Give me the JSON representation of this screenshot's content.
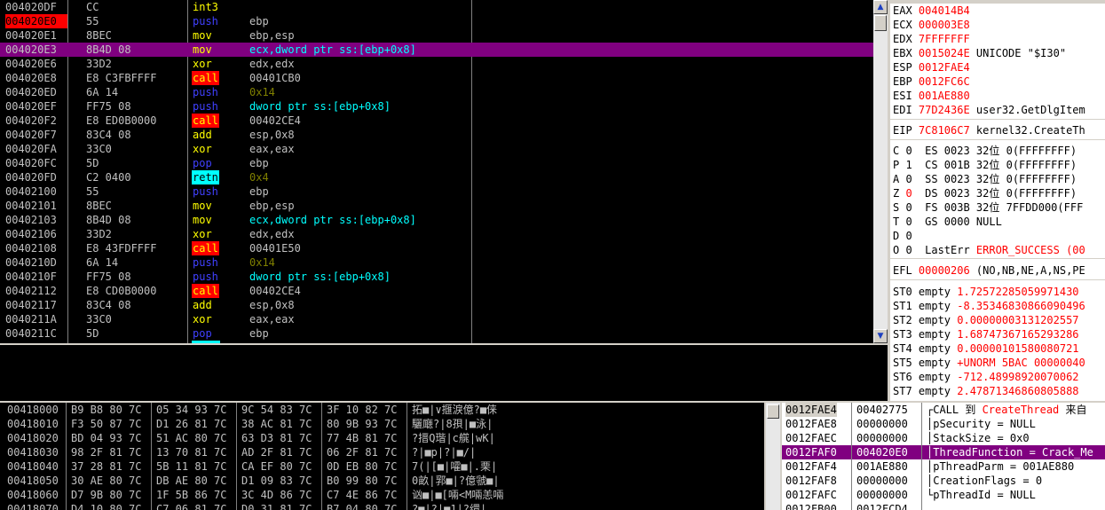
{
  "disasm": {
    "rows": [
      {
        "addr": "004020DF",
        "hex": "CC",
        "mn": "int3",
        "mk": "def",
        "op": "",
        "ok": "def"
      },
      {
        "addr": "004020E0",
        "hex": "55",
        "mn": "push",
        "mk": "stk",
        "op": "ebp",
        "ok": "def",
        "bp": true
      },
      {
        "addr": "004020E1",
        "hex": "8BEC",
        "mn": "mov",
        "mk": "def",
        "op": "ebp,esp",
        "ok": "def"
      },
      {
        "addr": "004020E3",
        "hex": "8B4D 08",
        "mn": "mov",
        "mk": "def",
        "op": "ecx,dword ptr ss:[ebp+0x8]",
        "ok": "mem",
        "sel": true
      },
      {
        "addr": "004020E6",
        "hex": "33D2",
        "mn": "xor",
        "mk": "def",
        "op": "edx,edx",
        "ok": "def"
      },
      {
        "addr": "004020E8",
        "hex": "E8 C3FBFFFF",
        "mn": "call",
        "mk": "call",
        "op": "00401CB0",
        "ok": "def"
      },
      {
        "addr": "004020ED",
        "hex": "6A 14",
        "mn": "push",
        "mk": "stk",
        "op": "0x14",
        "ok": "imm"
      },
      {
        "addr": "004020EF",
        "hex": "FF75 08",
        "mn": "push",
        "mk": "stk",
        "op": "dword ptr ss:[ebp+0x8]",
        "ok": "mem"
      },
      {
        "addr": "004020F2",
        "hex": "E8 ED0B0000",
        "mn": "call",
        "mk": "call",
        "op": "00402CE4",
        "ok": "def"
      },
      {
        "addr": "004020F7",
        "hex": "83C4 08",
        "mn": "add",
        "mk": "def",
        "op": "esp,0x8",
        "ok": "def"
      },
      {
        "addr": "004020FA",
        "hex": "33C0",
        "mn": "xor",
        "mk": "def",
        "op": "eax,eax",
        "ok": "def"
      },
      {
        "addr": "004020FC",
        "hex": "5D",
        "mn": "pop",
        "mk": "stk",
        "op": "ebp",
        "ok": "def"
      },
      {
        "addr": "004020FD",
        "hex": "C2 0400",
        "mn": "retn",
        "mk": "ret",
        "op": "0x4",
        "ok": "imm"
      },
      {
        "addr": "00402100",
        "hex": "55",
        "mn": "push",
        "mk": "stk",
        "op": "ebp",
        "ok": "def"
      },
      {
        "addr": "00402101",
        "hex": "8BEC",
        "mn": "mov",
        "mk": "def",
        "op": "ebp,esp",
        "ok": "def"
      },
      {
        "addr": "00402103",
        "hex": "8B4D 08",
        "mn": "mov",
        "mk": "def",
        "op": "ecx,dword ptr ss:[ebp+0x8]",
        "ok": "mem"
      },
      {
        "addr": "00402106",
        "hex": "33D2",
        "mn": "xor",
        "mk": "def",
        "op": "edx,edx",
        "ok": "def"
      },
      {
        "addr": "00402108",
        "hex": "E8 43FDFFFF",
        "mn": "call",
        "mk": "call",
        "op": "00401E50",
        "ok": "def"
      },
      {
        "addr": "0040210D",
        "hex": "6A 14",
        "mn": "push",
        "mk": "stk",
        "op": "0x14",
        "ok": "imm"
      },
      {
        "addr": "0040210F",
        "hex": "FF75 08",
        "mn": "push",
        "mk": "stk",
        "op": "dword ptr ss:[ebp+0x8]",
        "ok": "mem"
      },
      {
        "addr": "00402112",
        "hex": "E8 CD0B0000",
        "mn": "call",
        "mk": "call",
        "op": "00402CE4",
        "ok": "def"
      },
      {
        "addr": "00402117",
        "hex": "83C4 08",
        "mn": "add",
        "mk": "def",
        "op": "esp,0x8",
        "ok": "def"
      },
      {
        "addr": "0040211A",
        "hex": "33C0",
        "mn": "xor",
        "mk": "def",
        "op": "eax,eax",
        "ok": "def"
      },
      {
        "addr": "0040211C",
        "hex": "5D",
        "mn": "pop",
        "mk": "stk",
        "op": "ebp",
        "ok": "def"
      }
    ]
  },
  "registers": {
    "rows": [
      [
        {
          "t": "EAX "
        },
        {
          "t": "004014B4",
          "c": "red"
        }
      ],
      [
        {
          "t": "ECX "
        },
        {
          "t": "000003E8",
          "c": "red"
        }
      ],
      [
        {
          "t": "EDX "
        },
        {
          "t": "7FFFFFFF",
          "c": "red"
        }
      ],
      [
        {
          "t": "EBX "
        },
        {
          "t": "0015024E",
          "c": "red"
        },
        {
          "t": " UNICODE \"$I30\""
        }
      ],
      [
        {
          "t": "ESP "
        },
        {
          "t": "0012FAE4",
          "c": "red"
        }
      ],
      [
        {
          "t": "EBP "
        },
        {
          "t": "0012FC6C",
          "c": "red"
        }
      ],
      [
        {
          "t": "ESI "
        },
        {
          "t": "001AE880",
          "c": "red"
        }
      ],
      [
        {
          "t": "EDI "
        },
        {
          "t": "77D2436E",
          "c": "red"
        },
        {
          "t": " user32.GetDlgItem"
        }
      ],
      [],
      [
        {
          "t": "EIP "
        },
        {
          "t": "7C8106C7",
          "c": "red"
        },
        {
          "t": " kernel32.CreateTh"
        }
      ],
      [],
      [
        {
          "t": "C 0  ES 0023 32位 0(FFFFFFFF)"
        }
      ],
      [
        {
          "t": "P 1  CS 001B 32位 0(FFFFFFFF)"
        }
      ],
      [
        {
          "t": "A 0  SS 0023 32位 0(FFFFFFFF)"
        }
      ],
      [
        {
          "t": "Z "
        },
        {
          "t": "0",
          "c": "red"
        },
        {
          "t": "  DS 0023 32位 0(FFFFFFFF)"
        }
      ],
      [
        {
          "t": "S 0  FS 003B 32位 7FFDD000(FFF"
        }
      ],
      [
        {
          "t": "T 0  GS 0000 NULL"
        }
      ],
      [
        {
          "t": "D 0"
        }
      ],
      [
        {
          "t": "O 0  LastErr "
        },
        {
          "t": "ERROR_SUCCESS (00",
          "c": "red"
        }
      ],
      [],
      [
        {
          "t": "EFL "
        },
        {
          "t": "00000206",
          "c": "red"
        },
        {
          "t": " (NO,NB,NE,A,NS,PE"
        }
      ],
      [],
      [
        {
          "t": "ST0 empty "
        },
        {
          "t": "1.72572285059971430",
          "c": "red"
        }
      ],
      [
        {
          "t": "ST1 empty "
        },
        {
          "t": "-8.35346830866090496",
          "c": "red"
        }
      ],
      [
        {
          "t": "ST2 empty "
        },
        {
          "t": "0.00000003131202557",
          "c": "red"
        }
      ],
      [
        {
          "t": "ST3 empty "
        },
        {
          "t": "1.68747367165293286",
          "c": "red"
        }
      ],
      [
        {
          "t": "ST4 empty "
        },
        {
          "t": "0.00000101580080721",
          "c": "red"
        }
      ],
      [
        {
          "t": "ST5 empty "
        },
        {
          "t": "+UNORM 5BAC 00000040",
          "c": "red"
        }
      ],
      [
        {
          "t": "ST6 empty "
        },
        {
          "t": "-712.48998920070062",
          "c": "red"
        }
      ],
      [
        {
          "t": "ST7 empty "
        },
        {
          "t": "2.47871346860805888",
          "c": "red"
        }
      ]
    ]
  },
  "dump": {
    "rows": [
      {
        "addr": "00418000",
        "hex": [
          "B9 B8 80 7C",
          "05 34 93 7C",
          "9C 54 83 7C",
          "3F 10 82 7C"
        ],
        "ascii": "拓■|∨擓淚億?■俫"
      },
      {
        "addr": "00418010",
        "hex": [
          "F3 50 87 7C",
          "D1 26 81 7C",
          "38 AC 81 7C",
          "80 9B 93 7C"
        ],
        "ascii": "驪廰?|8孭|■泳|"
      },
      {
        "addr": "00418020",
        "hex": [
          "BD 04 93 7C",
          "51 AC 80 7C",
          "63 D3 81 7C",
          "77 4B 81 7C"
        ],
        "ascii": "?搢Q瑎|c艞|wK|"
      },
      {
        "addr": "00418030",
        "hex": [
          "98 2F 81 7C",
          "13 70 81 7C",
          "AD 2F 81 7C",
          "06 2F 81 7C"
        ],
        "ascii": "?|■p|?|■/|"
      },
      {
        "addr": "00418040",
        "hex": [
          "37 28 81 7C",
          "5B 11 81 7C",
          "CA EF 80 7C",
          "0D EB 80 7C"
        ],
        "ascii": "7(|[■|嚯■|.栗|"
      },
      {
        "addr": "00418050",
        "hex": [
          "30 AE 80 7C",
          "DB AE 80 7C",
          "D1 09 83 7C",
          "B0 99 80 7C"
        ],
        "ascii": "0畝|郛■|?億虢■|"
      },
      {
        "addr": "00418060",
        "hex": [
          "D7 9B 80 7C",
          "1F 5B 86 7C",
          "3C 4D 86 7C",
          "C7 4E 86 7C"
        ],
        "ascii": "讻■|■[啢<M啢恙啢"
      },
      {
        "addr": "00418070",
        "hex": [
          "D4 10 80 7C",
          "C7 06 81 7C",
          "D0 31 81 7C",
          "B7 04 80 7C"
        ],
        "ascii": "?■|?|■1|?缳|"
      }
    ]
  },
  "stack": {
    "rows": [
      {
        "a": "0012FAE4",
        "v": "00402775",
        "parts": [
          {
            "t": "┌CALL 到 "
          },
          {
            "t": "CreateThread",
            "c": "red"
          },
          {
            "t": " 来自"
          }
        ],
        "hl": true
      },
      {
        "a": "0012FAE8",
        "v": "00000000",
        "parts": [
          {
            "t": "│pSecurity = NULL"
          }
        ]
      },
      {
        "a": "0012FAEC",
        "v": "00000000",
        "parts": [
          {
            "t": "│StackSize = 0x0"
          }
        ]
      },
      {
        "a": "0012FAF0",
        "v": "004020E0",
        "parts": [
          {
            "t": "│ThreadFunction = Crack_Me"
          }
        ],
        "sel": true
      },
      {
        "a": "0012FAF4",
        "v": "001AE880",
        "parts": [
          {
            "t": "│pThreadParm = 001AE880"
          }
        ]
      },
      {
        "a": "0012FAF8",
        "v": "00000000",
        "parts": [
          {
            "t": "│CreationFlags = 0"
          }
        ]
      },
      {
        "a": "0012FAFC",
        "v": "00000000",
        "parts": [
          {
            "t": "└pThreadId = NULL"
          }
        ]
      },
      {
        "a": "0012FB00",
        "v": "0012FCD4",
        "parts": []
      }
    ]
  },
  "colors": {
    "bg": "#000000",
    "accent": "#800080",
    "breakpoint": "#ff0000",
    "call": "#ff0000",
    "ret": "#00ffff"
  }
}
